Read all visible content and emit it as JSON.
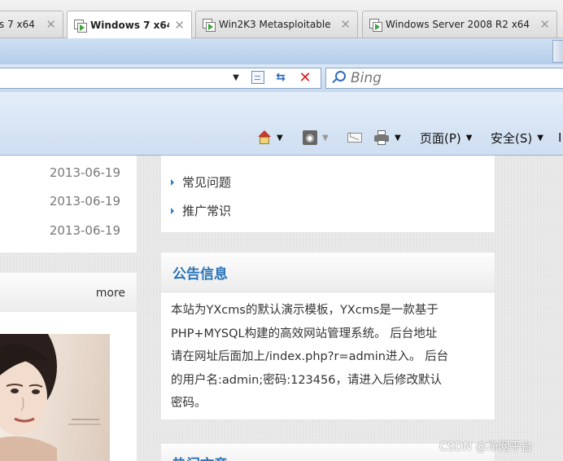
{
  "vm_tabs": [
    {
      "label": "s 7 x64",
      "active": false
    },
    {
      "label": "Windows 7 x64",
      "active": true
    },
    {
      "label": "Win2K3 Metasploitable",
      "active": false
    },
    {
      "label": "Windows Server 2008 R2 x64",
      "active": false
    }
  ],
  "browser": {
    "search_placeholder": "Bing",
    "commands": {
      "page_menu": "页面(P)",
      "safety_menu": "安全(S)",
      "tools_menu_partial": "I"
    }
  },
  "content": {
    "dates": [
      "2013-06-19",
      "2013-06-19",
      "2013-06-19"
    ],
    "more_link": "more",
    "categories_cut": "• • • • ...",
    "categories": [
      "常见问题",
      "推广常识"
    ],
    "notice": {
      "title": "公告信息",
      "lines": [
        "本站为YXcms的默认演示模板，YXcms是一款基于",
        "PHP+MYSQL构建的高效网站管理系统。 后台地址",
        "请在网址后面加上/index.php?r=admin进入。 后台",
        "的用户名:admin;密码:123456，请进入后修改默认",
        "密码。"
      ]
    },
    "hot_title": "热门文章"
  },
  "watermark": "CSDN @净网平台"
}
